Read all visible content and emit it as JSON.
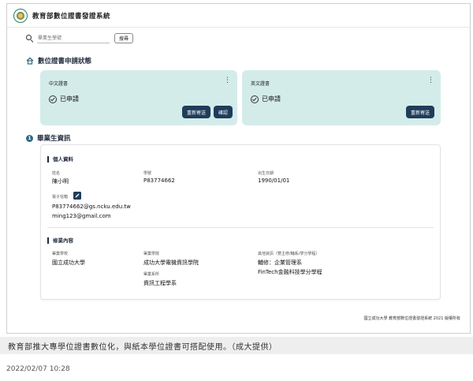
{
  "app": {
    "title": "教育部數位證書發證系統"
  },
  "search": {
    "placeholder": "畢業生學號",
    "button_label": "搜尋"
  },
  "status_section": {
    "title": "數位證書申請狀態",
    "cards": [
      {
        "label": "中文證書",
        "status": "已申請",
        "resend_label": "重新寄送",
        "confirm_label": "確認"
      },
      {
        "label": "英文證書",
        "status": "已申請",
        "resend_label": "重新寄送"
      }
    ]
  },
  "graduate_section": {
    "badge": "1",
    "title": "畢業生資訊",
    "personal": {
      "title": "個人資料",
      "name_label": "姓名",
      "name": "陳小明",
      "id_label": "學號",
      "id": "P83774662",
      "birth_label": "出生日期",
      "birth": "1990/01/01",
      "email_label": "電子信箱",
      "email_1": "P83774662@gs.ncku.edu.tw",
      "email_2": "ming123@gmail.com"
    },
    "study": {
      "title": "修業內容",
      "school_label": "畢業學校",
      "school": "國立成功大學",
      "college_label": "畢業學院",
      "college": "成功大學電機資訊學院",
      "dept_label": "畢業系所",
      "dept": "資訊工程學系",
      "other_label": "其他資訊（雙主修/輔系/學分學程）",
      "other_1": "輔修：企業管理系",
      "other_2": "FinTech金融科技學分學程"
    }
  },
  "footer": {
    "note": "國立成功大學 教育部數位證書發證系統 2021 版權所有"
  },
  "caption": "教育部推大專學位證書數位化，與紙本學位證書可搭配使用。（成大提供）",
  "date": "2022/02/07 10:28",
  "colors": {
    "card_bg": "#d3ecea",
    "button": "#1f3c5b",
    "badge": "#2d6b86"
  }
}
